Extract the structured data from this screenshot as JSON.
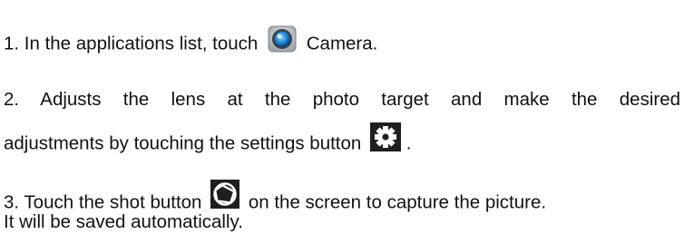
{
  "document": {
    "step1": {
      "before": "1. In the applications list, touch",
      "after": "Camera.",
      "icon": "camera-app-icon"
    },
    "step2": {
      "line1": "2. Adjusts the lens at the photo target and make the desired",
      "line2_before": "adjustments by touching the settings button",
      "line2_after": ".",
      "icon": "gear-icon"
    },
    "step3": {
      "line1_before": "3. Touch the shot button",
      "line1_after": "on the screen to capture the picture.",
      "line2": "It will be saved automatically.",
      "icon": "shutter-icon"
    }
  }
}
